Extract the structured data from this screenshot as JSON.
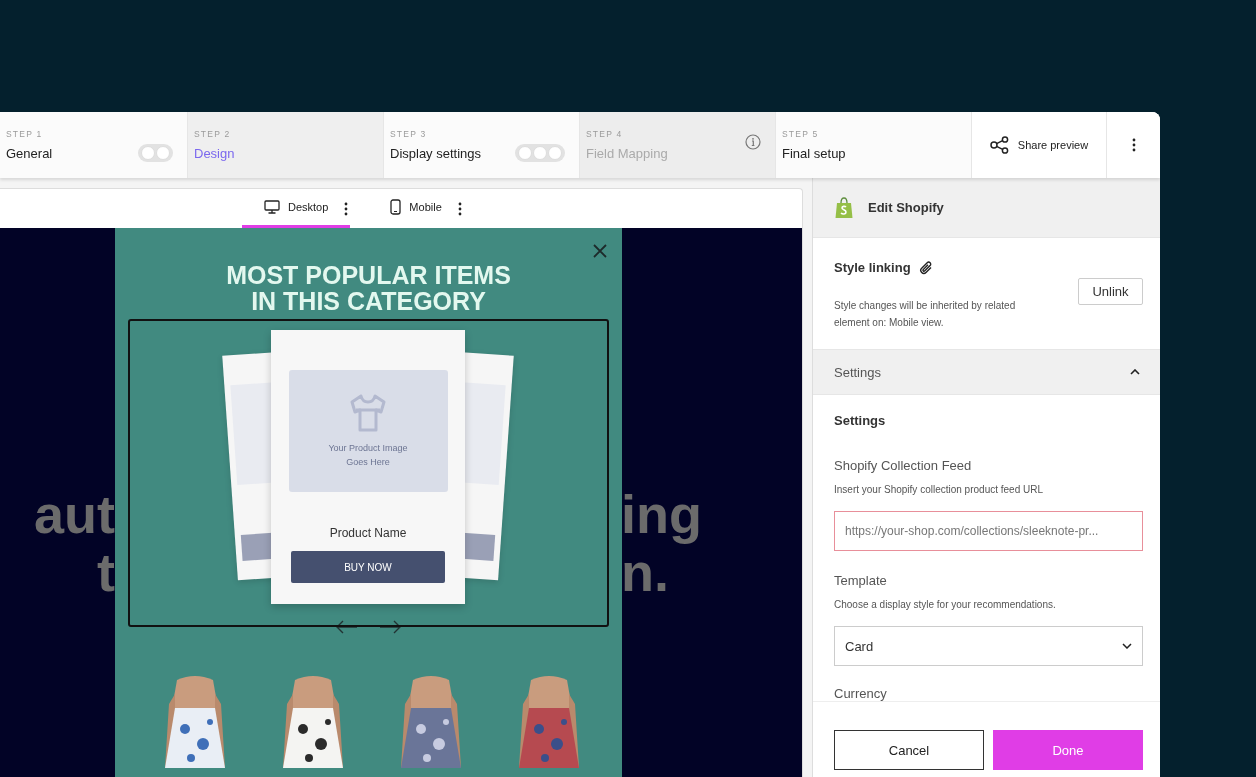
{
  "steps": [
    {
      "label": "STEP 1",
      "title": "General",
      "selected": false,
      "disabled": false,
      "kind": "dots2"
    },
    {
      "label": "STEP 2",
      "title": "Design",
      "selected": true,
      "disabled": false,
      "kind": "plain"
    },
    {
      "label": "STEP 3",
      "title": "Display settings",
      "selected": false,
      "disabled": false,
      "kind": "dots3"
    },
    {
      "label": "STEP 4",
      "title": "Field Mapping",
      "selected": false,
      "disabled": true,
      "kind": "info"
    },
    {
      "label": "STEP 5",
      "title": "Final setup",
      "selected": false,
      "disabled": false,
      "kind": "plain"
    }
  ],
  "share_button": "Share preview",
  "device_tabs": [
    {
      "label": "Desktop",
      "kind": "desktop",
      "selected": true
    },
    {
      "label": "Mobile",
      "kind": "mobile",
      "selected": false
    }
  ],
  "preview": {
    "background_text": [
      {
        "left": "aut",
        "right": "ing"
      },
      {
        "left": "t",
        "right": "n."
      }
    ],
    "heading": [
      "MOST POPULAR ITEMS",
      "IN THIS CATEGORY"
    ],
    "card": {
      "image_hint": "Your Product Image Goes Here",
      "product_name": "Product Name",
      "button": "BUY NOW"
    }
  },
  "panel": {
    "title": "Edit Shopify",
    "style_linking": {
      "title": "Style linking",
      "description": "Style changes will be inherited by related element on: Mobile view.",
      "button": "Unlink"
    },
    "accordion": {
      "title": "Settings",
      "expanded": true
    },
    "section_title": "Settings",
    "feed": {
      "label": "Shopify Collection Feed",
      "hint": "Insert your Shopify collection product feed URL",
      "value": "https://your-shop.com/collections/sleeknote-pr...",
      "invalid": true
    },
    "template": {
      "label": "Template",
      "hint": "Choose a display style for your recommendations.",
      "value": "Card"
    },
    "next_label": "Currency",
    "cancel": "Cancel",
    "done": "Done"
  }
}
